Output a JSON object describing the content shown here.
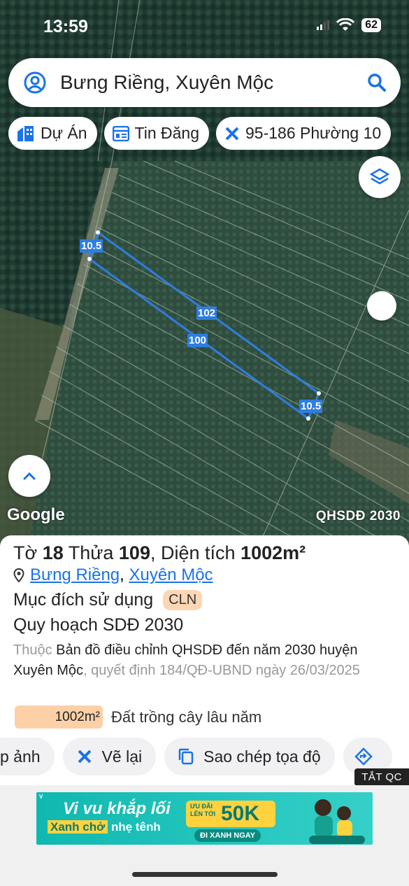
{
  "status_bar": {
    "time": "13:59",
    "battery": "62"
  },
  "search": {
    "query": "Bưng Riềng, Xuyên Mộc"
  },
  "chips": [
    {
      "label": "Dự Án",
      "icon": "building-icon"
    },
    {
      "label": "Tin Đăng",
      "icon": "listing-icon"
    },
    {
      "label": "95-186 Phường 10",
      "icon": "ruler-icon"
    }
  ],
  "map": {
    "attribution": "Google",
    "layer_label": "QHSDĐ 2030",
    "measurements": [
      "10.5",
      "102",
      "100",
      "10.5"
    ]
  },
  "parcel": {
    "sheet_label": "Tờ",
    "sheet_no": "18",
    "plot_label": "Thửa",
    "plot_no": "109",
    "area_label": ", Diện tích",
    "area_value": "1002m²",
    "location_1": "Bưng Riềng",
    "location_sep": ",",
    "location_2": "Xuyên Mộc",
    "purpose_label": "Mục đích sử dụng",
    "purpose_code": "CLN",
    "plan_title": "Quy hoạch SDĐ 2030",
    "desc_prefix": "Thuộc",
    "desc_main": "Bản đồ điều chỉnh QHSDĐ đến năm 2030 huyện Xuyên Mộc",
    "desc_suffix": ", quyết định 184/QĐ-UBND ngày 26/03/2025",
    "area_bar_value": "1002m²",
    "area_bar_label": "Đất trồng cây lâu năm"
  },
  "actions": [
    {
      "label": "p ảnh"
    },
    {
      "label": "Vẽ lại"
    },
    {
      "label": "Sao chép tọa độ"
    }
  ],
  "ad": {
    "close_label": "TẮT QC",
    "headline": "Vi vu khắp lối",
    "sub_highlight": "Xanh chở",
    "sub_rest": "nhẹ tênh",
    "promo_small": "ƯU ĐÃI LÊN TỚI",
    "promo_big": "50K",
    "cta": "ĐI XANH NGAY",
    "brand": "V"
  },
  "colors": {
    "accent": "#1a73e8",
    "badge": "#fdd7b4",
    "measure": "#2f7de0"
  }
}
